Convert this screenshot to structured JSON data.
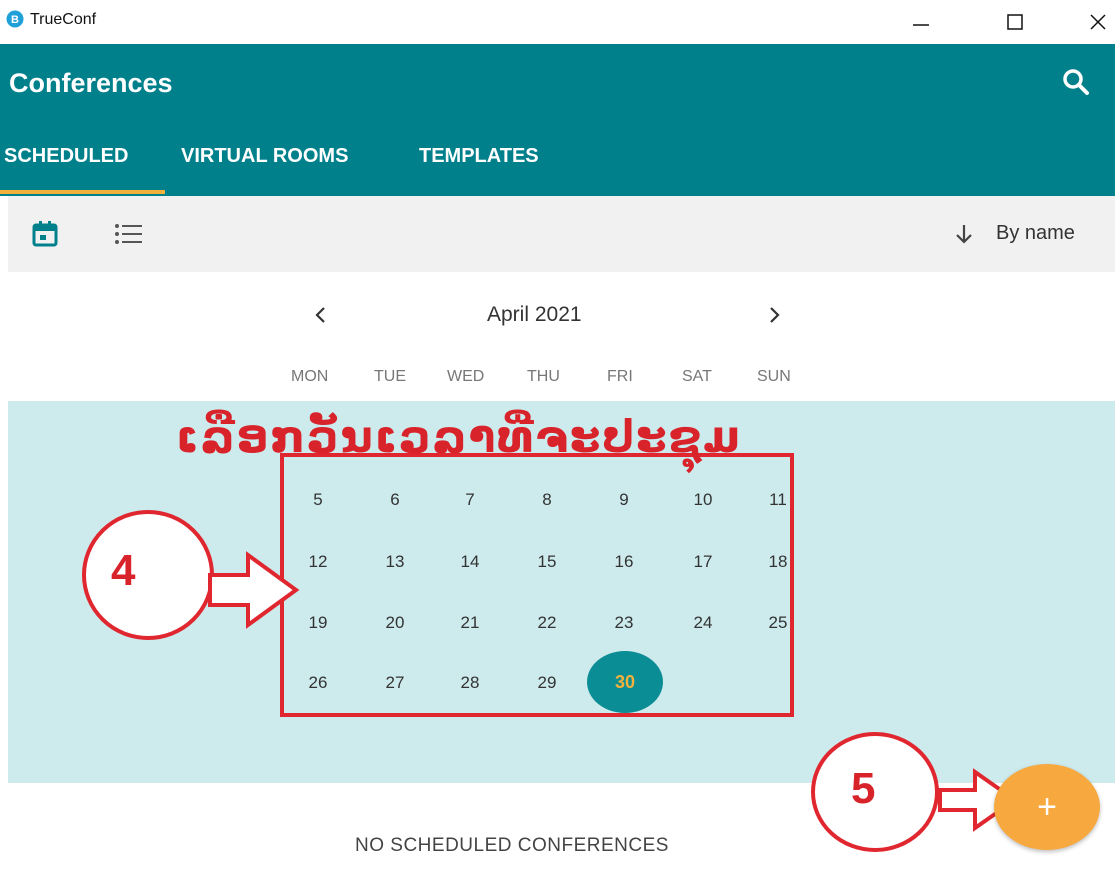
{
  "window": {
    "app_title": "TrueConf",
    "minimize_icon": "minimize-icon",
    "maximize_icon": "maximize-icon",
    "close_icon": "close-icon"
  },
  "header": {
    "title": "Conferences",
    "search_icon": "search-icon",
    "tabs": [
      {
        "label": "SCHEDULED",
        "active": true
      },
      {
        "label": "VIRTUAL ROOMS",
        "active": false
      },
      {
        "label": "TEMPLATES",
        "active": false
      }
    ],
    "accent_color": "#00808b",
    "tab_indicator_color": "#f2b13b"
  },
  "toolbar": {
    "calendar_view_icon": "calendar-icon",
    "list_view_icon": "list-icon",
    "sort_icon": "arrow-down-icon",
    "sort_label": "By name"
  },
  "calendar": {
    "prev_icon": "chevron-left-icon",
    "next_icon": "chevron-right-icon",
    "month_label": "April 2021",
    "weekdays": [
      "MON",
      "TUE",
      "WED",
      "THU",
      "FRI",
      "SAT",
      "SUN"
    ],
    "weeks": [
      [
        "5",
        "6",
        "7",
        "8",
        "9",
        "10",
        "11"
      ],
      [
        "12",
        "13",
        "14",
        "15",
        "16",
        "17",
        "18"
      ],
      [
        "19",
        "20",
        "21",
        "22",
        "23",
        "24",
        "25"
      ],
      [
        "26",
        "27",
        "28",
        "29",
        "30",
        "",
        ""
      ]
    ],
    "selected_day": "30",
    "body_color": "#cdeaed",
    "selected_color": "#0b8d96"
  },
  "annotations": {
    "instruction_text": "ເລືອກວັນເວລາທີ່ຈະປະຊຸມ",
    "step_4": "4",
    "step_5": "5",
    "color": "#d9232b"
  },
  "fab": {
    "label": "+",
    "color": "#f7a83f"
  },
  "empty_state": "NO SCHEDULED CONFERENCES"
}
